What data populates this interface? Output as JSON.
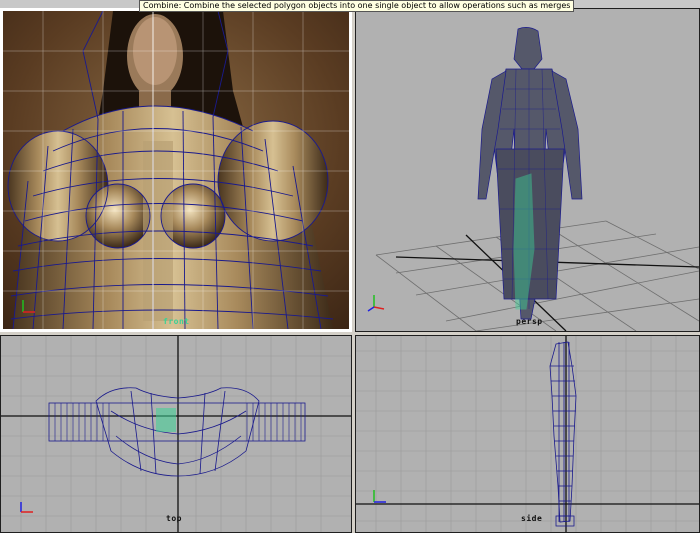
{
  "tooltip": {
    "text": "Combine: Combine the selected polygon objects into one single object to allow operations such as merges or face trims"
  },
  "viewports": {
    "front": {
      "label": "front"
    },
    "persp": {
      "label": "persp"
    },
    "top": {
      "label": "top"
    },
    "side": {
      "label": "side"
    }
  },
  "axis": {
    "x": "x",
    "y": "y",
    "z": "z"
  },
  "colors": {
    "viewport_bg": "#b1b1b1",
    "grid": "#9a9a9a",
    "grid_axis": "#111111",
    "wireframe": "#1a1a8c",
    "selection": "#3cd296",
    "active_border": "#ffffff",
    "axis_x": "#e02020",
    "axis_y": "#20c020",
    "axis_z": "#2020e0"
  }
}
